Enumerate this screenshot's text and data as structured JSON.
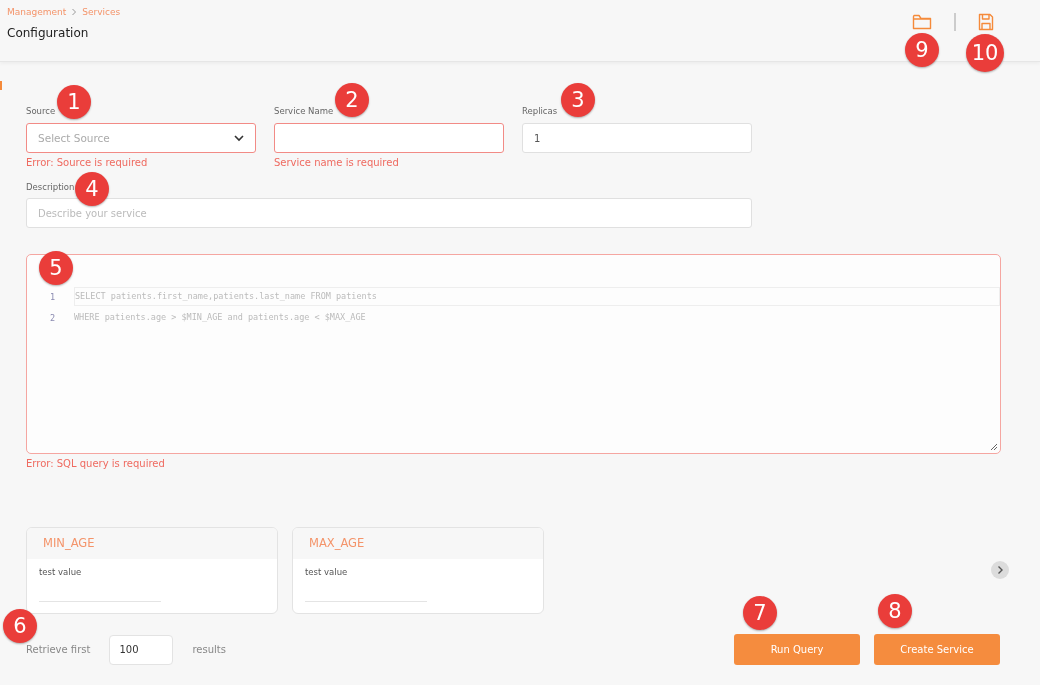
{
  "breadcrumb": [
    "Management",
    "Services"
  ],
  "title": "Configuration",
  "fields": [
    {
      "kind": "select",
      "label": "Source",
      "placeholder": "Select Source",
      "invalid": true,
      "error": "Error: Source is required"
    },
    {
      "kind": "text",
      "label": "Service Name",
      "invalid": true,
      "error": "Service name is required"
    },
    {
      "kind": "text",
      "label": "Replicas",
      "value": "1",
      "invalid": false
    }
  ],
  "description": {
    "label": "Description",
    "placeholder": "Describe your service",
    "invalid": false
  },
  "editor": {
    "invalid": true,
    "error": "Error: SQL query is required",
    "lines": [
      {
        "number": "1",
        "code": "SELECT patients.first_name,patients.last_name FROM patients",
        "selected": true
      },
      {
        "number": "2",
        "code": "WHERE patients.age > $MIN_AGE and patients.age < $MAX_AGE",
        "selected": false
      }
    ]
  },
  "variables": [
    {
      "name": "MIN_AGE",
      "label": "test value"
    },
    {
      "name": "MAX_AGE",
      "label": "test value"
    }
  ],
  "retrieve": {
    "prefix": "Retrieve first",
    "value": "100",
    "suffix": "results"
  },
  "buttons": [
    "Run Query",
    "Create Service"
  ],
  "callouts": [
    "1",
    "2",
    "3",
    "4",
    "5",
    "6",
    "7",
    "8",
    "9",
    "10"
  ]
}
